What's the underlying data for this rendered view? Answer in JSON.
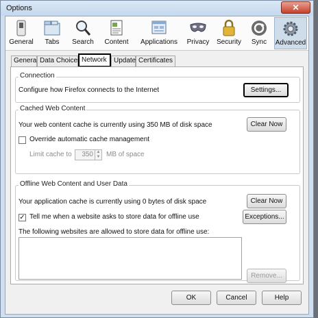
{
  "window": {
    "title": "Options",
    "close_glyph": "✕"
  },
  "toolbar": {
    "panes": [
      {
        "label": "General",
        "icon": "switch-icon"
      },
      {
        "label": "Tabs",
        "icon": "tabs-icon"
      },
      {
        "label": "Search",
        "icon": "magnifier-icon"
      },
      {
        "label": "Content",
        "icon": "content-page-icon"
      },
      {
        "label": "Applications",
        "icon": "applications-icon"
      },
      {
        "label": "Privacy",
        "icon": "mask-icon"
      },
      {
        "label": "Security",
        "icon": "padlock-icon"
      },
      {
        "label": "Sync",
        "icon": "sync-icon"
      },
      {
        "label": "Advanced",
        "icon": "gear-icon"
      }
    ],
    "active_pane": "Advanced"
  },
  "subtabs": [
    "General",
    "Data Choices",
    "Network",
    "Update",
    "Certificates"
  ],
  "active_subtab": "Network",
  "connection": {
    "legend": "Connection",
    "description": "Configure how Firefox connects to the Internet",
    "settings_button": "Settings..."
  },
  "cache": {
    "legend": "Cached Web Content",
    "status": "Your web content cache is currently using 350 MB of disk space",
    "clear_button": "Clear Now",
    "override_label": "Override automatic cache management",
    "override_checked": false,
    "limit_label": "Limit cache to",
    "limit_value": "350",
    "limit_unit": "MB of space"
  },
  "offline": {
    "legend": "Offline Web Content and User Data",
    "status": "Your application cache is currently using 0 bytes of disk space",
    "clear_button": "Clear Now",
    "tell_me_label": "Tell me when a website asks to store data for offline use",
    "tell_me_checked": true,
    "exceptions_button": "Exceptions...",
    "allowed_label": "The following websites are allowed to store data for offline use:",
    "remove_button": "Remove..."
  },
  "footer": {
    "ok": "OK",
    "cancel": "Cancel",
    "help": "Help"
  }
}
